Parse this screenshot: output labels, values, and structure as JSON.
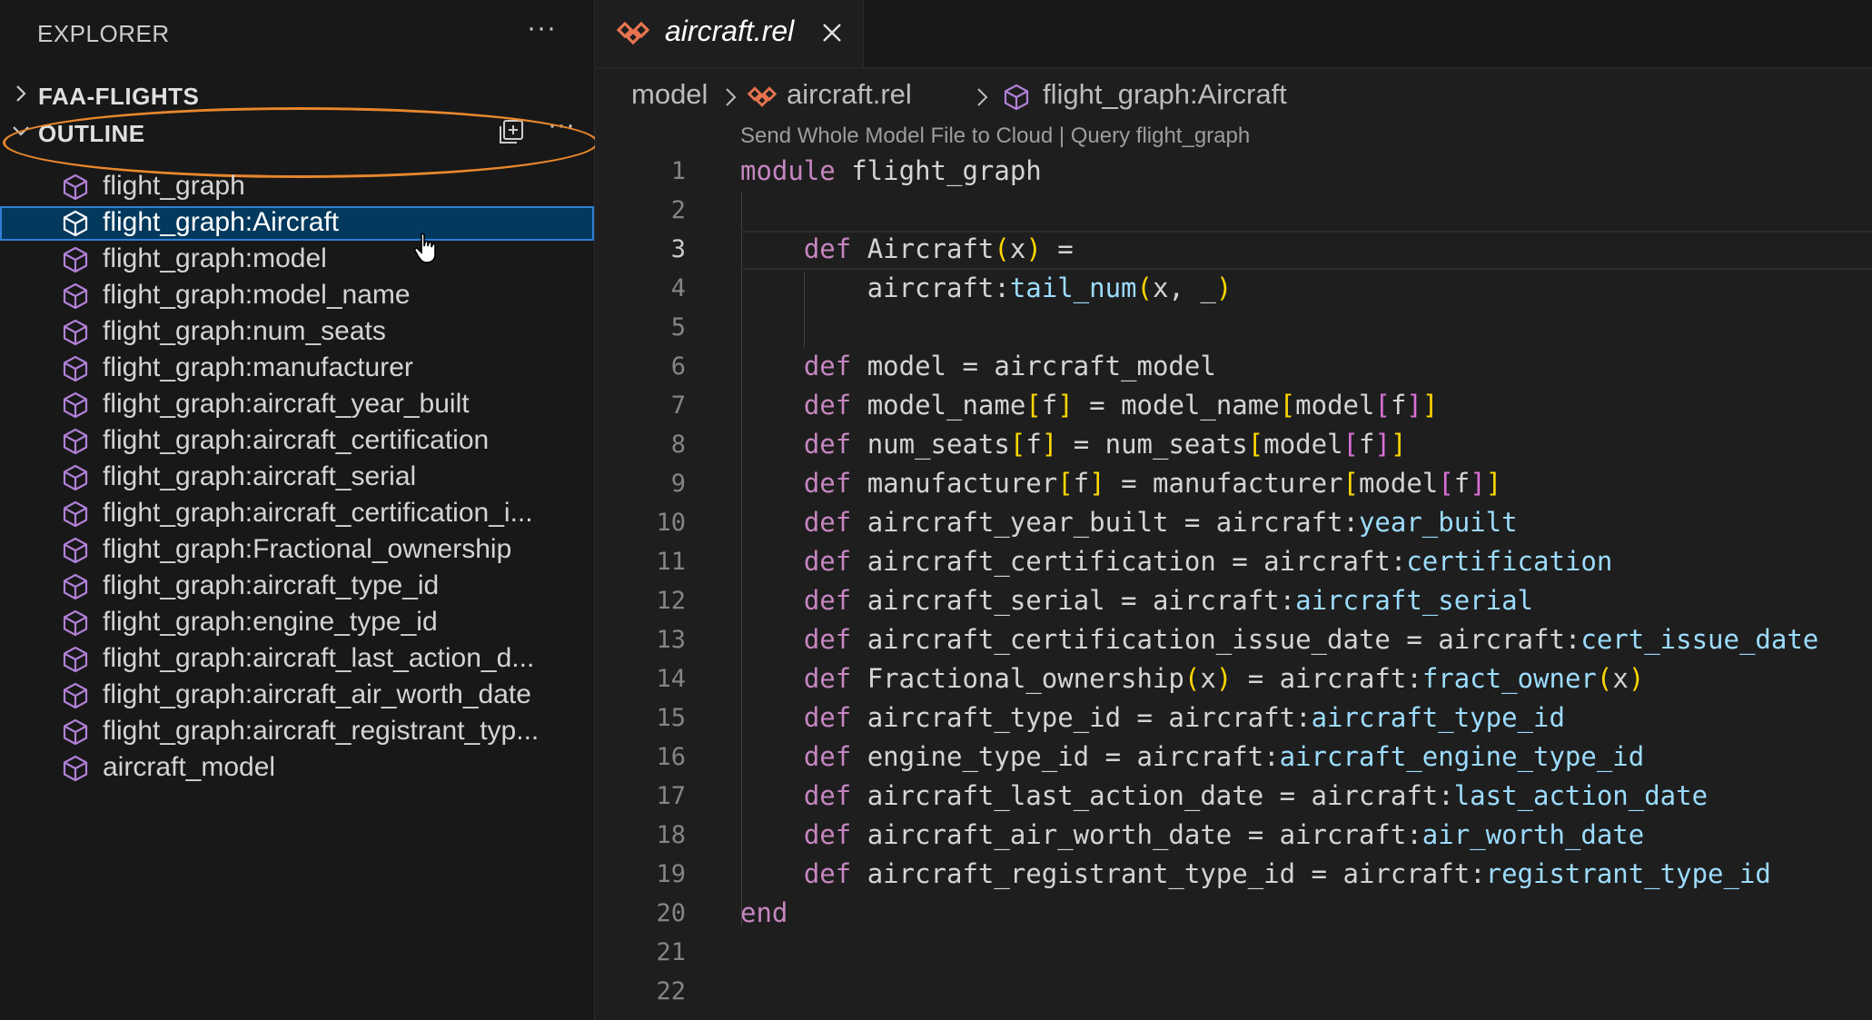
{
  "sidebar": {
    "title": "EXPLORER",
    "more": "···",
    "sections": {
      "faa": "FAA-FLIGHTS",
      "outline": "OUTLINE"
    },
    "outline_items": [
      {
        "label": "flight_graph"
      },
      {
        "label": "flight_graph:Aircraft"
      },
      {
        "label": "flight_graph:model"
      },
      {
        "label": "flight_graph:model_name"
      },
      {
        "label": "flight_graph:num_seats"
      },
      {
        "label": "flight_graph:manufacturer"
      },
      {
        "label": "flight_graph:aircraft_year_built"
      },
      {
        "label": "flight_graph:aircraft_certification"
      },
      {
        "label": "flight_graph:aircraft_serial"
      },
      {
        "label": "flight_graph:aircraft_certification_i..."
      },
      {
        "label": "flight_graph:Fractional_ownership"
      },
      {
        "label": "flight_graph:aircraft_type_id"
      },
      {
        "label": "flight_graph:engine_type_id"
      },
      {
        "label": "flight_graph:aircraft_last_action_d..."
      },
      {
        "label": "flight_graph:aircraft_air_worth_date"
      },
      {
        "label": "flight_graph:aircraft_registrant_typ..."
      },
      {
        "label": "aircraft_model"
      }
    ],
    "selected_index": 1
  },
  "editor": {
    "tab": {
      "name": "aircraft.rel"
    },
    "breadcrumb": {
      "folder": "model",
      "file": "aircraft.rel",
      "symbol": "flight_graph:Aircraft"
    },
    "codelens": "Send Whole Model File to Cloud | Query flight_graph",
    "active_line": 3,
    "line_numbers": [
      "1",
      "2",
      "3",
      "4",
      "5",
      "6",
      "7",
      "8",
      "9",
      "10",
      "11",
      "12",
      "13",
      "14",
      "15",
      "16",
      "17",
      "18",
      "19",
      "20",
      "21",
      "22"
    ]
  },
  "colors": {
    "accent_selection": "#04395e",
    "highlight_ring": "#e8872c",
    "icon_purple": "#b180d7",
    "file_icon_orange": "#e8744f"
  }
}
